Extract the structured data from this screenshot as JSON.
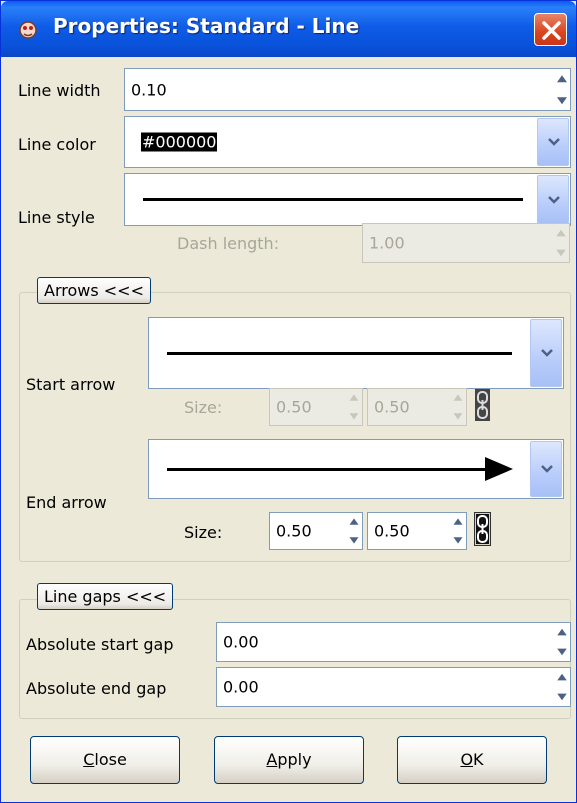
{
  "window": {
    "title": "Properties: Standard - Line",
    "icon": "app-icon",
    "close_icon": "close-icon"
  },
  "line_width": {
    "label": "Line width",
    "value": "0.10"
  },
  "line_color": {
    "label": "Line color",
    "value": "#000000"
  },
  "line_style": {
    "label": "Line style"
  },
  "dash_length": {
    "label": "Dash length:",
    "value": "1.00"
  },
  "arrows": {
    "toggle_label": "Arrows <<<",
    "start_arrow": {
      "label": "Start arrow",
      "size_label": "Size:",
      "size_w": "0.50",
      "size_h": "0.50"
    },
    "end_arrow": {
      "label": "End arrow",
      "size_label": "Size:",
      "size_w": "0.50",
      "size_h": "0.50"
    }
  },
  "line_gaps": {
    "toggle_label": "Line gaps <<<",
    "abs_start": {
      "label": "Absolute start gap",
      "value": "0.00"
    },
    "abs_end": {
      "label": "Absolute end gap",
      "value": "0.00"
    }
  },
  "buttons": {
    "close": {
      "mnemonic": "C",
      "rest": "lose"
    },
    "apply": {
      "mnemonic": "A",
      "rest": "pply"
    },
    "ok": {
      "mnemonic": "O",
      "rest": "K"
    }
  },
  "colors": {
    "title_bar": "#0a5cf0",
    "dialog_bg": "#ece9d8",
    "field_border": "#7f9db9",
    "disabled_text": "#a7a698"
  }
}
